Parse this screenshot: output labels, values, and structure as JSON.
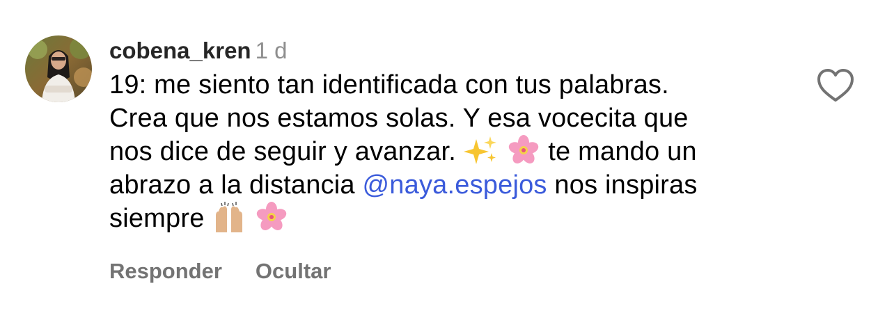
{
  "comment": {
    "username": "cobena_kren",
    "time": "1 d",
    "text_parts": {
      "line1": "19: me siento tan identificada con tus palabras.",
      "line2": "Crea que nos estamos solas. Y esa vocecita que",
      "line3_a": "nos dice de seguir y avanzar.",
      "line3_b": "te mando un",
      "line4_a": "abrazo a la distancia",
      "mention": "@naya.espejos",
      "line4_b": "nos inspiras",
      "line5_a": "siempre"
    },
    "emojis": [
      "sparkles-emoji",
      "cherry-blossom-emoji",
      "raising-hands-emoji",
      "cherry-blossom-emoji"
    ],
    "avatar_icon": "profile-photo",
    "like_icon": "heart-outline-icon"
  },
  "actions": {
    "reply_label": "Responder",
    "hide_label": "Ocultar"
  },
  "colors": {
    "username": "#262626",
    "time": "#8e8e8e",
    "mention": "#3b5bdb",
    "actions": "#737373",
    "heart_outline": "#737373"
  }
}
